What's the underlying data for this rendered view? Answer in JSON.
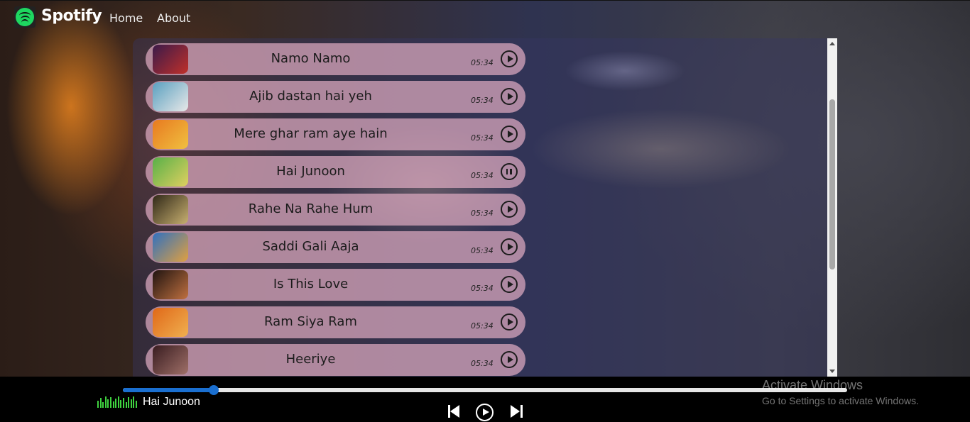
{
  "nav": {
    "brand": "Spotify",
    "links": [
      "Home",
      "About"
    ]
  },
  "songs": [
    {
      "name": "Namo Namo",
      "duration": "05:34",
      "state": "play",
      "thumb_colors": [
        "#3a1a4a",
        "#c0302a"
      ]
    },
    {
      "name": "Ajib dastan hai yeh",
      "duration": "05:34",
      "state": "play",
      "thumb_colors": [
        "#5aa0c0",
        "#e8e8e8"
      ]
    },
    {
      "name": "Mere ghar ram aye hain",
      "duration": "05:34",
      "state": "play",
      "thumb_colors": [
        "#e87a20",
        "#f0c040"
      ]
    },
    {
      "name": "Hai Junoon",
      "duration": "05:34",
      "state": "pause",
      "thumb_colors": [
        "#58b048",
        "#e0d060"
      ]
    },
    {
      "name": "Rahe Na Rahe Hum",
      "duration": "05:34",
      "state": "play",
      "thumb_colors": [
        "#302818",
        "#c8b070"
      ]
    },
    {
      "name": "Saddi Gali Aaja",
      "duration": "05:34",
      "state": "play",
      "thumb_colors": [
        "#3070c0",
        "#e0a040"
      ]
    },
    {
      "name": "Is This Love",
      "duration": "05:34",
      "state": "play",
      "thumb_colors": [
        "#201410",
        "#c07040"
      ]
    },
    {
      "name": "Ram Siya Ram",
      "duration": "05:34",
      "state": "play",
      "thumb_colors": [
        "#e06818",
        "#f0b050"
      ]
    },
    {
      "name": "Heeriye",
      "duration": "05:34",
      "state": "play",
      "thumb_colors": [
        "#381c20",
        "#a07068"
      ]
    }
  ],
  "player": {
    "now_playing": "Hai Junoon",
    "progress": 0.125,
    "accent": "#1a6fd0",
    "eq_color": "#3fd23f"
  },
  "watermark": {
    "title": "Activate Windows",
    "subtitle": "Go to Settings to activate Windows."
  }
}
